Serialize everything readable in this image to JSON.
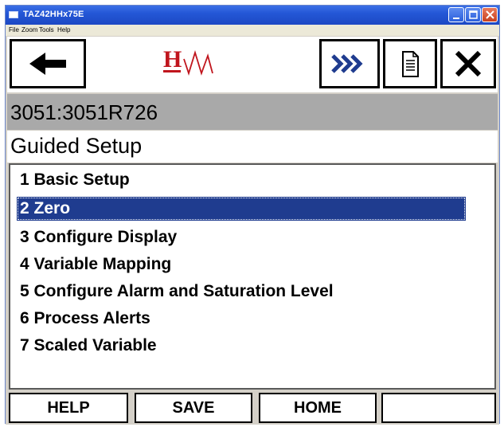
{
  "window": {
    "title": "TAZ42HHx75E",
    "colors": {
      "titlebar": "#2457d6",
      "selection": "#1f3c8f",
      "device_bar": "#a9a9a9"
    }
  },
  "menubar": {
    "items": [
      "File",
      "Zoom",
      "Tools",
      "Help"
    ]
  },
  "toolbar": {
    "back_icon": "arrow-left-icon",
    "logo_icon": "hw-logo-icon",
    "logo_text": "H",
    "next_icon": "fast-forward-icon",
    "page_icon": "document-icon",
    "close_icon": "close-x-icon"
  },
  "device": {
    "tag": "3051:3051R726"
  },
  "screen": {
    "title": "Guided Setup"
  },
  "menu": {
    "items": [
      {
        "label": "1 Basic Setup",
        "selected": false
      },
      {
        "label": "2 Zero",
        "selected": true
      },
      {
        "label": "3 Configure Display",
        "selected": false
      },
      {
        "label": "4 Variable Mapping",
        "selected": false
      },
      {
        "label": "5 Configure Alarm and Saturation Level",
        "selected": false
      },
      {
        "label": "6 Process Alerts",
        "selected": false
      },
      {
        "label": "7 Scaled Variable",
        "selected": false
      }
    ]
  },
  "softkeys": {
    "help": "HELP",
    "save": "SAVE",
    "home": "HOME"
  }
}
